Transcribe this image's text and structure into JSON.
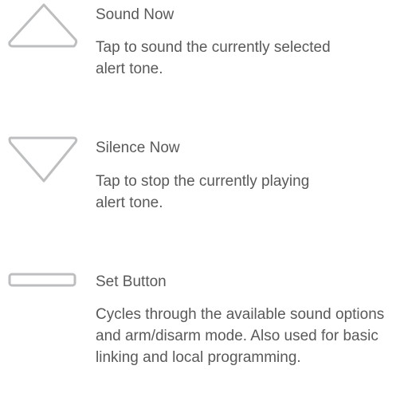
{
  "items": [
    {
      "icon": "triangle-up-icon",
      "title": "Sound Now",
      "description": "Tap to sound the currently selected alert tone."
    },
    {
      "icon": "triangle-down-icon",
      "title": "Silence Now",
      "description": "Tap to stop the currently playing alert tone."
    },
    {
      "icon": "rounded-rect-button-icon",
      "title": "Set Button",
      "description": "Cycles through the available sound options and arm/disarm mode. Also used for basic linking and local programming."
    }
  ],
  "colors": {
    "text": "#58595b",
    "icon_stroke": "#bcbec0"
  }
}
